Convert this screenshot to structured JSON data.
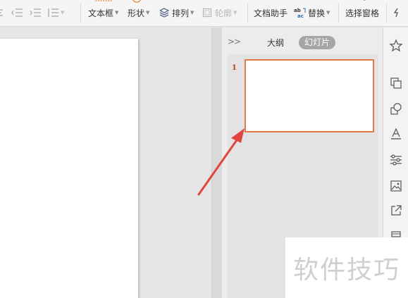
{
  "ribbon": {
    "text_box_label": "文本框",
    "shape_label": "形状",
    "arrange_label": "排列",
    "outline_label": "轮廓",
    "doc_assistant_label": "文档助手",
    "replace_label": "替换",
    "selection_pane_label": "选择窗格"
  },
  "panel": {
    "tabs": [
      {
        "label": "大纲",
        "active": false
      },
      {
        "label": "幻灯片",
        "active": true
      }
    ],
    "slides": [
      {
        "number": "1",
        "selected": true
      }
    ]
  },
  "colors": {
    "selection_border": "#e07a4a",
    "arrow": "#e0463f",
    "active_tab_bg": "#a6a6a6"
  },
  "right_bar_icons": [
    "star-icon",
    "copy-icon",
    "shapes-icon",
    "text-fill-icon",
    "settings-sliders-icon",
    "picture-icon",
    "share-icon",
    "print-icon"
  ],
  "watermark": {
    "text": "软件技巧"
  }
}
